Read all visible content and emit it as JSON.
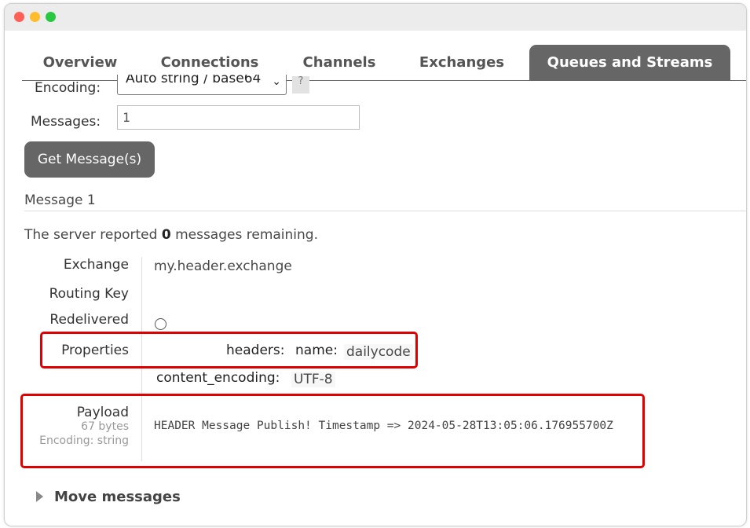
{
  "tabs": [
    "Overview",
    "Connections",
    "Channels",
    "Exchanges",
    "Queues and Streams"
  ],
  "active_tab": "Queues and Streams",
  "form": {
    "encoding_label": "Encoding:",
    "encoding_value": "Auto string / base64",
    "help_label": "?",
    "messages_label": "Messages:",
    "messages_value": "1",
    "get_button": "Get Message(s)"
  },
  "message": {
    "title": "Message 1",
    "reported_prefix": "The server reported",
    "reported_count": "0",
    "reported_suffix": "messages remaining.",
    "exchange_label": "Exchange",
    "exchange_value": "my.header.exchange",
    "routing_key_label": "Routing Key",
    "redelivered_label": "Redelivered",
    "properties_label": "Properties",
    "headers_key": "headers:",
    "header_name_key": "name:",
    "header_name_value": "dailycode",
    "content_encoding_key": "content_encoding:",
    "content_encoding_value": "UTF-8",
    "payload_label": "Payload",
    "payload_bytes": "67 bytes",
    "payload_encoding": "Encoding: string",
    "payload_text": "HEADER Message Publish! Timestamp => 2024-05-28T13:05:06.176955700Z"
  },
  "move_messages": "Move messages",
  "colors": {
    "highlight": "#e10000",
    "tab_active": "#666666",
    "button": "#666666"
  }
}
